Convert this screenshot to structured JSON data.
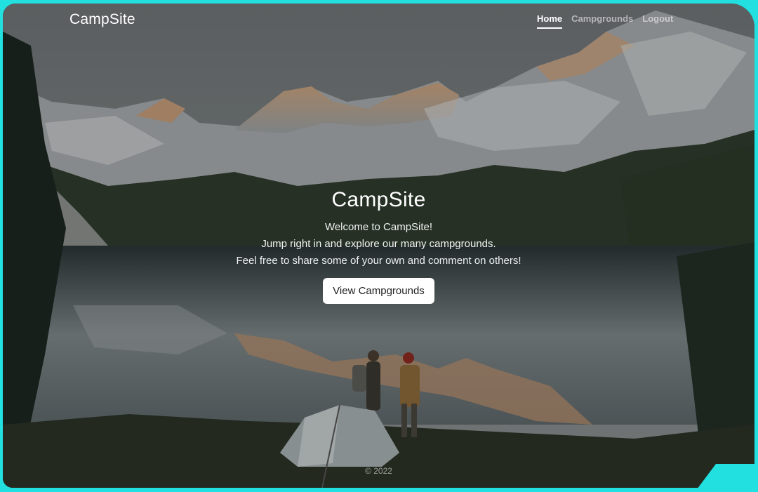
{
  "navbar": {
    "brand": "CampSite",
    "links": [
      {
        "label": "Home"
      },
      {
        "label": "Campgrounds"
      },
      {
        "label": "Logout"
      }
    ]
  },
  "hero": {
    "title": "CampSite",
    "lines": [
      "Welcome to CampSite!",
      "Jump right in and explore our many campgrounds.",
      "Feel free to share some of your own and comment on others!"
    ],
    "button_label": "View Campgrounds"
  },
  "footer": {
    "text": "© 2022"
  },
  "colors": {
    "frame": "#22e0e0",
    "button_bg": "#ffffff",
    "text": "#ffffff"
  },
  "background": {
    "icon": "mountain-lake-campsite-photo"
  }
}
